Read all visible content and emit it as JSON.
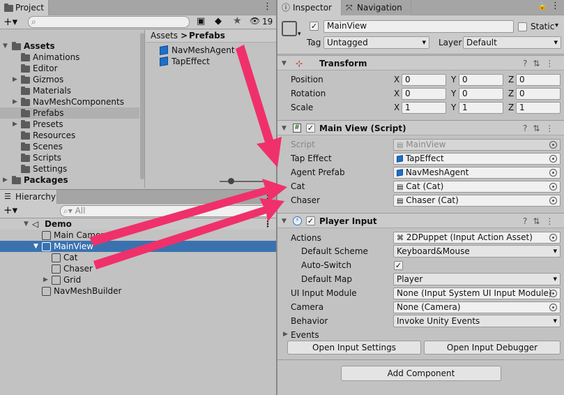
{
  "project": {
    "tab_label": "Project",
    "hidden_count": "19",
    "tree": [
      {
        "label": "Assets",
        "bold": true
      },
      {
        "label": "Animations"
      },
      {
        "label": "Editor"
      },
      {
        "label": "Gizmos"
      },
      {
        "label": "Materials"
      },
      {
        "label": "NavMeshComponents"
      },
      {
        "label": "Prefabs"
      },
      {
        "label": "Presets"
      },
      {
        "label": "Resources"
      },
      {
        "label": "Scenes"
      },
      {
        "label": "Scripts"
      },
      {
        "label": "Settings"
      },
      {
        "label": "Packages",
        "bold": true
      }
    ],
    "breadcrumb": {
      "root": "Assets",
      "sep": ">",
      "current": "Prefabs"
    },
    "files": [
      "NavMeshAgent",
      "TapEffect"
    ]
  },
  "hierarchy": {
    "tab_label": "Hierarchy",
    "search_placeholder": "All",
    "items": [
      "Demo",
      "Main Camera",
      "MainView",
      "Cat",
      "Chaser",
      "Grid",
      "NavMeshBuilder"
    ]
  },
  "inspector": {
    "tab_label": "Inspector",
    "nav_tab_label": "Navigation",
    "object_name": "MainView",
    "static_label": "Static",
    "tag_label": "Tag",
    "tag_value": "Untagged",
    "layer_label": "Layer",
    "layer_value": "Default",
    "transform": {
      "title": "Transform",
      "rows": [
        {
          "label": "Position",
          "x": "0",
          "y": "0",
          "z": "0"
        },
        {
          "label": "Rotation",
          "x": "0",
          "y": "0",
          "z": "0"
        },
        {
          "label": "Scale",
          "x": "1",
          "y": "1",
          "z": "1"
        }
      ],
      "axis_x": "X",
      "axis_y": "Y",
      "axis_z": "Z"
    },
    "main_view": {
      "title": "Main View (Script)",
      "script_label": "Script",
      "script_value": "MainView",
      "tap_label": "Tap Effect",
      "tap_value": "TapEffect",
      "agent_label": "Agent Prefab",
      "agent_value": "NavMeshAgent",
      "cat_label": "Cat",
      "cat_value": "Cat (Cat)",
      "chaser_label": "Chaser",
      "chaser_value": "Chaser (Cat)"
    },
    "player_input": {
      "title": "Player Input",
      "actions_label": "Actions",
      "actions_value": "2DPuppet (Input Action Asset)",
      "scheme_label": "Default Scheme",
      "scheme_value": "Keyboard&Mouse",
      "autoswitch_label": "Auto-Switch",
      "map_label": "Default Map",
      "map_value": "Player",
      "ui_label": "UI Input Module",
      "ui_value": "None (Input System UI Input Module)",
      "camera_label": "Camera",
      "camera_value": "None (Camera)",
      "behavior_label": "Behavior",
      "behavior_value": "Invoke Unity Events",
      "events_label": "Events",
      "open_settings": "Open Input Settings",
      "open_debugger": "Open Input Debugger"
    },
    "add_component": "Add Component"
  },
  "colors": {
    "arrow": "#f0306a",
    "selection": "#3a72b0",
    "accent_blue": "#1f6fc9"
  }
}
